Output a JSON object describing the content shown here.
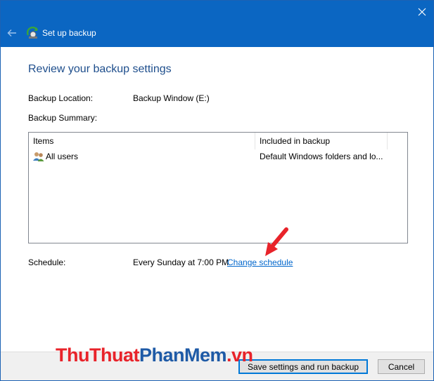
{
  "window": {
    "title": "Set up backup"
  },
  "page": {
    "heading": "Review your backup settings",
    "location_label": "Backup Location:",
    "location_value": "Backup Window (E:)",
    "summary_label": "Backup Summary:",
    "schedule_label": "Schedule:",
    "schedule_value": "Every Sunday at 7:00 PM",
    "change_schedule_link": "Change schedule"
  },
  "table": {
    "columns": [
      "Items",
      "Included in backup"
    ],
    "rows": [
      {
        "item": "All users",
        "included": "Default Windows folders and lo..."
      }
    ]
  },
  "footer": {
    "save_button": "Save settings and run backup",
    "cancel_button": "Cancel"
  },
  "watermark": {
    "part1": "ThuThuat",
    "part2": "PhanMem",
    "part3": ".vn"
  },
  "colors": {
    "titlebar": "#0b66c2",
    "heading": "#1e4e8c",
    "link": "#0066cc",
    "arrow": "#e8232a"
  },
  "icons": {
    "close": "close-icon",
    "back": "back-arrow-icon",
    "app": "backup-app-icon",
    "users": "users-icon"
  }
}
